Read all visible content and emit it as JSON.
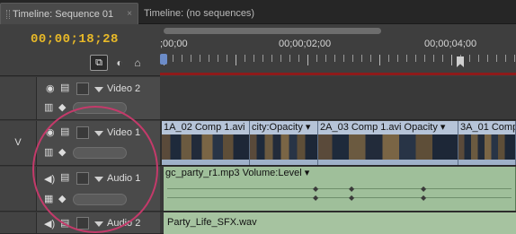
{
  "tabs": [
    {
      "label": "Timeline: Sequence 01",
      "close": "×"
    },
    {
      "label": "Timeline: (no sequences)"
    }
  ],
  "timecode": "00;00;18;28",
  "ruler": {
    "labels": [
      ";00;00",
      "00;00;02;00",
      "00;00;04;00"
    ]
  },
  "tracks": [
    {
      "id": "V2",
      "name": "Video 2",
      "side_label": ""
    },
    {
      "id": "V1",
      "name": "Video 1",
      "side_label": "V"
    },
    {
      "id": "A1",
      "name": "Audio 1",
      "side_label": ""
    },
    {
      "id": "A2",
      "name": "Audio 2",
      "side_label": ""
    }
  ],
  "clips": {
    "video1": [
      {
        "title": "1A_02 Comp 1.avi"
      },
      {
        "title": "city:Opacity ▾"
      },
      {
        "title": "2A_03 Comp 1.avi  Opacity ▾"
      },
      {
        "title": "3A_01 Comp"
      }
    ],
    "audio1": {
      "title": "gc_party_r1.mp3  Volume:Level ▾"
    },
    "audio2": {
      "title": "Party_Life_SFX.wav"
    }
  },
  "icons": {
    "eye": "eye-icon",
    "film": "film-icon",
    "speaker": "speaker-icon",
    "snap": "snap-icon",
    "marker": "marker-icon",
    "home": "home-icon"
  },
  "colors": {
    "timecode": "#e8b928",
    "highlight": "#c43a6a",
    "video_clip": "#b9c7d9",
    "audio_clip": "#9fbf9a",
    "work_area": "#8f1a1a"
  }
}
